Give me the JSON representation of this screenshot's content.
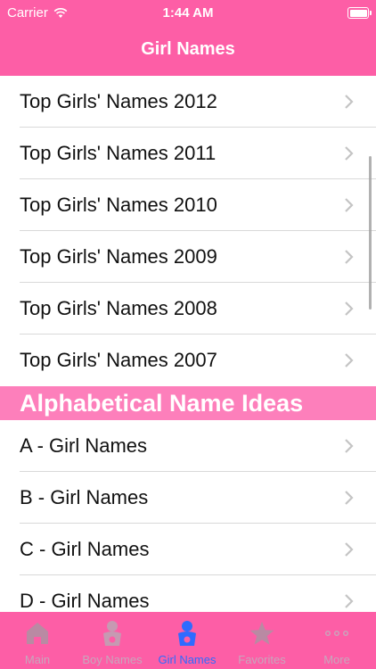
{
  "status": {
    "carrier": "Carrier",
    "time": "1:44 AM"
  },
  "nav": {
    "title": "Girl Names"
  },
  "top_rows": [
    {
      "label": "Top Girls' Names 2012"
    },
    {
      "label": "Top Girls' Names 2011"
    },
    {
      "label": "Top Girls' Names 2010"
    },
    {
      "label": "Top Girls' Names 2009"
    },
    {
      "label": "Top Girls' Names 2008"
    },
    {
      "label": "Top Girls' Names 2007"
    }
  ],
  "section": {
    "title": "Alphabetical Name Ideas"
  },
  "alpha_rows": [
    {
      "label": "A - Girl Names"
    },
    {
      "label": "B - Girl Names"
    },
    {
      "label": "C - Girl Names"
    },
    {
      "label": "D - Girl Names"
    }
  ],
  "tabs": [
    {
      "label": "Main",
      "icon": "house-icon"
    },
    {
      "label": "Boy Names",
      "icon": "baby-boy-icon"
    },
    {
      "label": "Girl Names",
      "icon": "baby-girl-icon",
      "active": true
    },
    {
      "label": "Favorites",
      "icon": "star-icon"
    },
    {
      "label": "More",
      "icon": "more-icon"
    }
  ],
  "colors": {
    "header": "#fd5ea6",
    "section": "#fd7fbb",
    "tab_active": "#2f6bff",
    "tab_inactive": "#c7a7bd"
  }
}
